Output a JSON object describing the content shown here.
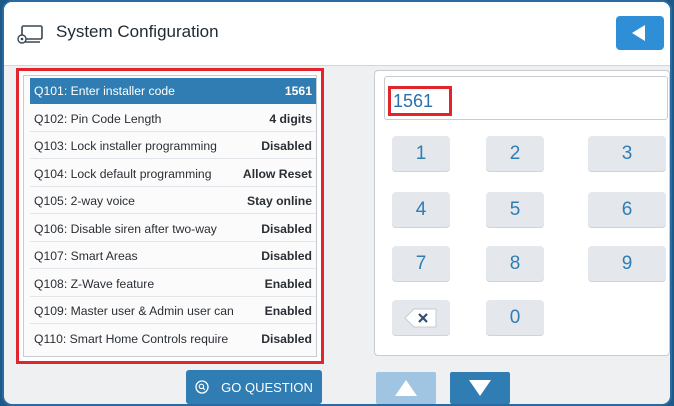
{
  "header": {
    "title": "System Configuration",
    "icon": "settings-panel-icon"
  },
  "questions": [
    {
      "label": "Q101: Enter installer code",
      "value": "1561",
      "selected": true
    },
    {
      "label": "Q102: Pin Code Length",
      "value": "4 digits"
    },
    {
      "label": "Q103: Lock installer programming",
      "value": "Disabled"
    },
    {
      "label": "Q104: Lock default programming",
      "value": "Allow Reset"
    },
    {
      "label": "Q105: 2-way voice",
      "value": "Stay online"
    },
    {
      "label": "Q106: Disable siren after two-way",
      "value": "Disabled"
    },
    {
      "label": "Q107: Smart Areas",
      "value": "Disabled"
    },
    {
      "label": "Q108: Z-Wave feature",
      "value": "Enabled"
    },
    {
      "label": "Q109: Master user & Admin user can",
      "value": "Enabled"
    },
    {
      "label": "Q110: Smart Home Controls require",
      "value": "Disabled"
    }
  ],
  "entry": {
    "value": "1561"
  },
  "keypad": {
    "k1": "1",
    "k2": "2",
    "k3": "3",
    "k4": "4",
    "k5": "5",
    "k6": "6",
    "k7": "7",
    "k8": "8",
    "k9": "9",
    "k0": "0"
  },
  "go_button": {
    "label": "GO QUESTION"
  },
  "colors": {
    "accent": "#2f7db3",
    "highlight": "#e0262c",
    "frame": "#1d5a8a"
  }
}
